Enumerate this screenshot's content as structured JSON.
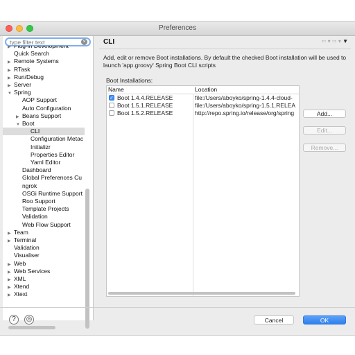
{
  "window": {
    "title": "Preferences"
  },
  "filter": {
    "placeholder": "type filter text",
    "value": "type filter text"
  },
  "tree": [
    {
      "label": "Plug-in Development",
      "expandable": true,
      "level": 0
    },
    {
      "label": "Quick Search",
      "expandable": false,
      "level": 0
    },
    {
      "label": "Remote Systems",
      "expandable": true,
      "level": 0
    },
    {
      "label": "RTask",
      "expandable": true,
      "level": 0
    },
    {
      "label": "Run/Debug",
      "expandable": true,
      "level": 0
    },
    {
      "label": "Server",
      "expandable": true,
      "level": 0
    },
    {
      "label": "Spring",
      "expandable": true,
      "expanded": true,
      "level": 0
    },
    {
      "label": "AOP Support",
      "expandable": false,
      "level": 1
    },
    {
      "label": "Auto Configuration",
      "expandable": false,
      "level": 1
    },
    {
      "label": "Beans Support",
      "expandable": true,
      "level": 1
    },
    {
      "label": "Boot",
      "expandable": true,
      "expanded": true,
      "level": 1
    },
    {
      "label": "CLI",
      "expandable": false,
      "level": 2,
      "selected": true
    },
    {
      "label": "Configuration Metac",
      "expandable": false,
      "level": 2
    },
    {
      "label": "Initializr",
      "expandable": false,
      "level": 2
    },
    {
      "label": "Properties Editor",
      "expandable": false,
      "level": 2
    },
    {
      "label": "Yaml Editor",
      "expandable": false,
      "level": 2
    },
    {
      "label": "Dashboard",
      "expandable": false,
      "level": 1
    },
    {
      "label": "Global Preferences Cu",
      "expandable": false,
      "level": 1
    },
    {
      "label": "ngrok",
      "expandable": false,
      "level": 1
    },
    {
      "label": "OSGi Runtime Support",
      "expandable": false,
      "level": 1
    },
    {
      "label": "Roo Support",
      "expandable": false,
      "level": 1
    },
    {
      "label": "Template Projects",
      "expandable": false,
      "level": 1
    },
    {
      "label": "Validation",
      "expandable": false,
      "level": 1
    },
    {
      "label": "Web Flow Support",
      "expandable": false,
      "level": 1
    },
    {
      "label": "Team",
      "expandable": true,
      "level": 0
    },
    {
      "label": "Terminal",
      "expandable": true,
      "level": 0
    },
    {
      "label": "Validation",
      "expandable": false,
      "level": 0
    },
    {
      "label": "Visualiser",
      "expandable": false,
      "level": 0
    },
    {
      "label": "Web",
      "expandable": true,
      "level": 0
    },
    {
      "label": "Web Services",
      "expandable": true,
      "level": 0
    },
    {
      "label": "XML",
      "expandable": true,
      "level": 0
    },
    {
      "label": "Xtend",
      "expandable": true,
      "level": 0
    },
    {
      "label": "Xtext",
      "expandable": true,
      "level": 0
    }
  ],
  "page": {
    "title": "CLI",
    "description": "Add, edit or remove Boot installations. By default the checked Boot installation will be used to launch 'app.groovy' Spring Boot CLI scripts",
    "section_label": "Boot Installations:"
  },
  "table": {
    "columns": [
      "Name",
      "Location"
    ],
    "rows": [
      {
        "checked": true,
        "name": "Boot 1.4.4.RELEASE",
        "location": "file:/Users/aboyko/spring-1.4.4-cloud-"
      },
      {
        "checked": false,
        "name": "Boot 1.5.1.RELEASE",
        "location": "file:/Users/aboyko/spring-1.5.1.RELEA"
      },
      {
        "checked": false,
        "name": "Boot 1.5.2.RELEASE",
        "location": "http://repo.spring.io/release/org/spring"
      }
    ]
  },
  "buttons": {
    "add": "Add...",
    "edit": "Edit...",
    "remove": "Remove..."
  },
  "footer": {
    "cancel": "Cancel",
    "ok": "OK",
    "help_glyph": "?",
    "record_glyph": "◎"
  },
  "nav": {
    "back": "⇦ ▾",
    "forward": "⇨ ▾",
    "menu": "▼"
  },
  "colors": {
    "accent": "#2f80ed",
    "selection": "#dcdcdc"
  }
}
